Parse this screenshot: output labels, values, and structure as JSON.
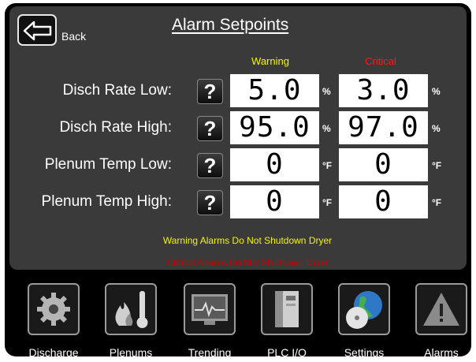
{
  "header": {
    "back_label": "Back",
    "title": "Alarm Setpoints"
  },
  "columns": {
    "warning": "Warning",
    "critical": "Critical"
  },
  "rows": [
    {
      "label": "Disch Rate Low:",
      "warning": "5.0",
      "critical": "3.0",
      "unit": "%"
    },
    {
      "label": "Disch Rate High:",
      "warning": "95.0",
      "critical": "97.0",
      "unit": "%"
    },
    {
      "label": "Plenum Temp Low:",
      "warning": "0",
      "critical": "0",
      "unit": "°F"
    },
    {
      "label": "Plenum Temp High:",
      "warning": "0",
      "critical": "0",
      "unit": "°F"
    }
  ],
  "help_glyph": "?",
  "notes": {
    "warning": "Warning Alarms Do Not Shutdown Dryer",
    "critical": "Critical Alarms Do Not Shutdown Dryer"
  },
  "nav": [
    {
      "label": "Discharge",
      "icon": "gear-icon"
    },
    {
      "label": "Plenums",
      "icon": "flame-thermometer-icon"
    },
    {
      "label": "Trending",
      "icon": "monitor-graph-icon"
    },
    {
      "label": "PLC I/O",
      "icon": "plc-module-icon"
    },
    {
      "label": "Settings",
      "icon": "globe-cd-icon"
    },
    {
      "label": "Alarms",
      "icon": "warning-triangle-icon"
    }
  ],
  "colors": {
    "warning": "#f4f400",
    "critical": "#ff1a1a",
    "panel": "#3a3a3a"
  }
}
